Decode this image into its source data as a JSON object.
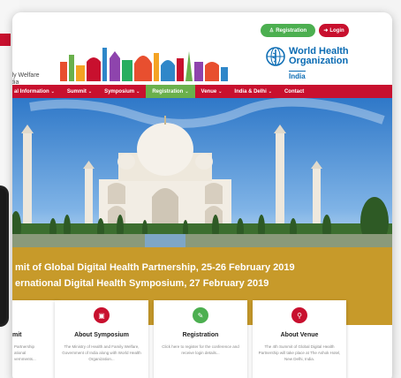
{
  "header": {
    "logo_text": "ily Welfare\ndia",
    "registration_button": "Registration",
    "login_button": "Login",
    "org_name_line1": "World Health",
    "org_name_line2": "Organization",
    "org_country": "India"
  },
  "nav": {
    "items": [
      {
        "label": "al Information",
        "caret": "⌄"
      },
      {
        "label": "Summit",
        "caret": "⌄"
      },
      {
        "label": "Symposium",
        "caret": "⌄"
      },
      {
        "label": "Registration",
        "caret": "⌄"
      },
      {
        "label": "Venue",
        "caret": "⌄"
      },
      {
        "label": "India & Delhi",
        "caret": "⌄"
      },
      {
        "label": "Contact",
        "caret": ""
      }
    ],
    "active_index": 3
  },
  "banner": {
    "line1": "mit of Global Digital Health Partnership, 25-26 February 2019",
    "line2": "ernational Digital Health Symposium, 27 February 2019"
  },
  "cards": [
    {
      "title": "mit",
      "desc": "Partnership\national\nvernments..."
    },
    {
      "title": "About Symposium",
      "desc": "The Ministry of Health and Family Welfare, Government of India along with World Health Organization..."
    },
    {
      "title": "Registration",
      "desc": "Click here to register for the conference and receive login details..."
    },
    {
      "title": "About Venue",
      "desc": "The 4th Summit of Global Digital Health Partnership will take place at The Ashok Hotel, New Delhi, India."
    }
  ],
  "colors": {
    "primary_red": "#c8102e",
    "accent_green": "#6ab04c",
    "banner_gold": "#c79a2a",
    "who_blue": "#0a6bb3"
  },
  "icons": {
    "hero_next": "chevron-right-icon",
    "registration": "user-plus-icon",
    "login": "sign-in-icon",
    "symposium": "presentation-icon",
    "register_card": "edit-icon",
    "venue": "map-marker-icon"
  }
}
